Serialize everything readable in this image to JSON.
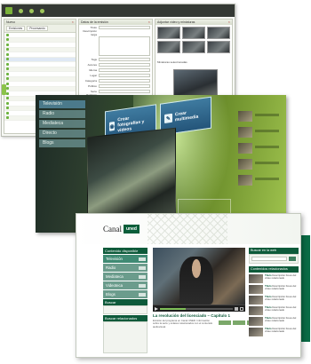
{
  "admin": {
    "panels": {
      "list_header": "Nuevo",
      "form_header": "Datos de la emisión",
      "media_header": "Adjuntar vídeo y miniaturas"
    },
    "list_tabs": [
      "Emisiones",
      "Procesando"
    ],
    "list_columns": [
      "Fecha",
      "Título"
    ],
    "form_fields": [
      "Título",
      "Descripción larga",
      "Tags",
      "Autores",
      "Idioma",
      "Lugar",
      "Categoría",
      "Público",
      "Serie",
      "Palabras clave",
      "Fecha de emisión"
    ],
    "media_subtitle": "Miniaturas seleccionadas",
    "media_buttons": [
      "Descargar",
      "Subir",
      "Recortar"
    ]
  },
  "tv3d": {
    "nav": [
      "Televisión",
      "Radio",
      "Mediateca",
      "Directo",
      "Blogs"
    ],
    "buttons": [
      {
        "label": "Crear fotografías y vídeos",
        "icon": "camera-icon"
      },
      {
        "label": "Crear multimedia",
        "icon": "pencil-icon"
      }
    ]
  },
  "canal": {
    "brand_text": "Canal",
    "brand_badge": "uned",
    "menu_header": "Contenido disponible",
    "menu_items": [
      "Televisión",
      "Radio",
      "Mediateca",
      "Videoteca",
      "Blogs"
    ],
    "box1_header": "Buscar",
    "box2_header": "Buscar relacionados",
    "video_title": "La revolución del licenciado – Capítulo 1",
    "video_desc": "Emisión del programa en Canal UNED. Información sobre la serie y enlaces relacionados con el contenido audiovisual.",
    "progress": 0.35,
    "right_header1": "Buscar en la web",
    "right_header2": "Contenidos relacionados",
    "related": [
      {
        "title": "Título",
        "text": "Descripción breve del vídeo relacionado"
      },
      {
        "title": "Título",
        "text": "Descripción breve del vídeo relacionado"
      },
      {
        "title": "Título",
        "text": "Descripción breve del vídeo relacionado"
      },
      {
        "title": "Título",
        "text": "Descripción breve del vídeo relacionado"
      },
      {
        "title": "Título",
        "text": "Descripción breve del vídeo relacionado"
      },
      {
        "title": "Título",
        "text": "Descripción breve del vídeo relacionado"
      }
    ]
  },
  "colors": {
    "brand_green": "#0a5e3a",
    "accent_green": "#7bb23a"
  }
}
